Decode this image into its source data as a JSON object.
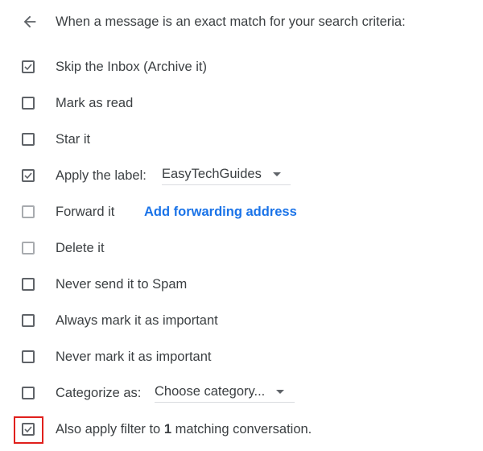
{
  "header": {
    "back_icon": "arrow-left-icon",
    "title": "When a message is an exact match for your search criteria:"
  },
  "options": [
    {
      "label": "Skip the Inbox (Archive it)",
      "checked": true,
      "disabled": false
    },
    {
      "label": "Mark as read",
      "checked": false,
      "disabled": false
    },
    {
      "label": "Star it",
      "checked": false,
      "disabled": false
    },
    {
      "label": "Apply the label:",
      "checked": true,
      "disabled": false,
      "select_value": "EasyTechGuides"
    },
    {
      "label": "Forward it",
      "checked": false,
      "disabled": true,
      "link": "Add forwarding address"
    },
    {
      "label": "Delete it",
      "checked": false,
      "disabled": true
    },
    {
      "label": "Never send it to Spam",
      "checked": false,
      "disabled": false
    },
    {
      "label": "Always mark it as important",
      "checked": false,
      "disabled": false
    },
    {
      "label": "Never mark it as important",
      "checked": false,
      "disabled": false
    },
    {
      "label": "Categorize as:",
      "checked": false,
      "disabled": false,
      "select_value": "Choose category..."
    },
    {
      "label_prefix": "Also apply filter to ",
      "count": "1",
      "label_suffix": " matching conversation.",
      "checked": true,
      "disabled": false
    }
  ],
  "colors": {
    "link": "#1a73e8",
    "highlight": "#e0201c",
    "checkbox": "#5f6368",
    "checkbox_disabled": "#a8abaf"
  }
}
